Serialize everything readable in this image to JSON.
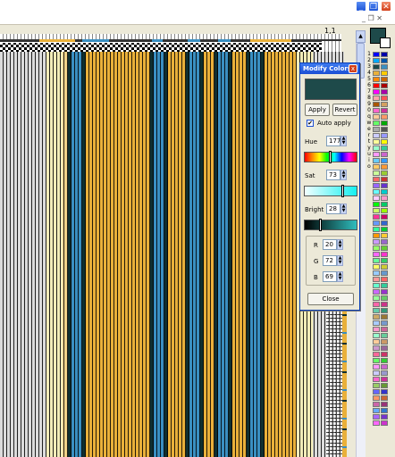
{
  "window": {
    "buttons": [
      "_",
      "❐",
      "✕"
    ],
    "secondary_buttons": [
      "_",
      "❐",
      "✕"
    ]
  },
  "status": {
    "coords": "1,1"
  },
  "dialog": {
    "title": "Modify Colors",
    "close_x": "x",
    "preview_color": "#1e4a4a",
    "apply_label": "Apply",
    "revert_label": "Revert",
    "auto_apply_label": "Auto apply",
    "auto_apply_checked": true,
    "hue_label": "Hue",
    "hue_value": "177",
    "sat_label": "Sat",
    "sat_value": "73",
    "bright_label": "Bright",
    "bright_value": "28",
    "r_label": "R",
    "r_value": "20",
    "g_label": "G",
    "g_value": "72",
    "b_label": "B",
    "b_value": "69",
    "close_label": "Close",
    "hue_fraction": 0.49,
    "sat_fraction": 0.73,
    "bright_fraction": 0.28
  },
  "palette": {
    "current_color": "#1e4a4a",
    "keys": [
      "1",
      "2",
      "3",
      "4",
      "5",
      "6",
      "7",
      "8",
      "9",
      "0",
      "q",
      "w",
      "e",
      "r",
      "t",
      "y",
      "u",
      "i",
      "o"
    ],
    "colors": [
      [
        "#0000ff",
        "#0000aa"
      ],
      [
        "#00aaff",
        "#0055aa"
      ],
      [
        "#1e4a4a",
        "#3a8fc1"
      ],
      [
        "#e9b03a",
        "#ffcc00"
      ],
      [
        "#ff8800",
        "#cc6600"
      ],
      [
        "#ff0000",
        "#aa0000"
      ],
      [
        "#ff00ff",
        "#aa00aa"
      ],
      [
        "#ffaaaa",
        "#ff5555"
      ],
      [
        "#aa5500",
        "#d4a060"
      ],
      [
        "#ff66cc",
        "#cc3399"
      ],
      [
        "#ffcc99",
        "#ff9966"
      ],
      [
        "#66ff66",
        "#00aa00"
      ],
      [
        "#aaaaaa",
        "#555555"
      ],
      [
        "#ccccff",
        "#9999ff"
      ],
      [
        "#ffff99",
        "#ffff00"
      ],
      [
        "#99ffcc",
        "#33cc99"
      ],
      [
        "#ff99ff",
        "#cc66cc"
      ],
      [
        "#66ccff",
        "#3399ff"
      ],
      [
        "#ffcc66",
        "#ff9933"
      ],
      [
        "#ccff99",
        "#99cc33"
      ],
      [
        "#ff6666",
        "#cc3333"
      ],
      [
        "#9966ff",
        "#6633cc"
      ],
      [
        "#66ffff",
        "#00cccc"
      ],
      [
        "#ffccff",
        "#ff99cc"
      ],
      [
        "#00ff00",
        "#00cc66"
      ],
      [
        "#ccff66",
        "#99ff00"
      ],
      [
        "#ff3399",
        "#cc0066"
      ],
      [
        "#6699ff",
        "#3366cc"
      ],
      [
        "#33ff99",
        "#00cc33"
      ],
      [
        "#ff9900",
        "#ffcc33"
      ],
      [
        "#cc99ff",
        "#9966cc"
      ],
      [
        "#99ff66",
        "#66cc33"
      ],
      [
        "#ff66ff",
        "#ff33cc"
      ],
      [
        "#66ff99",
        "#33cc66"
      ],
      [
        "#ffff66",
        "#cccc33"
      ],
      [
        "#99ccff",
        "#6699cc"
      ],
      [
        "#ff9999",
        "#ff6666"
      ],
      [
        "#66ffcc",
        "#33cc99"
      ],
      [
        "#cc66ff",
        "#9933cc"
      ],
      [
        "#99ff99",
        "#66cc66"
      ],
      [
        "#ff66aa",
        "#cc3388"
      ],
      [
        "#66ccaa",
        "#339977"
      ],
      [
        "#ccaa66",
        "#997733"
      ],
      [
        "#aaccff",
        "#7799cc"
      ],
      [
        "#ff99cc",
        "#cc6699"
      ],
      [
        "#99ffcc",
        "#66cc99"
      ],
      [
        "#ffcc99",
        "#cc9966"
      ],
      [
        "#cc99cc",
        "#996699"
      ],
      [
        "#ff6699",
        "#cc3366"
      ],
      [
        "#66ff66",
        "#33cc33"
      ],
      [
        "#ff99ff",
        "#cc66cc"
      ],
      [
        "#ccccff",
        "#9999cc"
      ],
      [
        "#ff66cc",
        "#cc3399"
      ],
      [
        "#99cc66",
        "#669933"
      ],
      [
        "#6666ff",
        "#3333cc"
      ],
      [
        "#ff9966",
        "#cc6633"
      ],
      [
        "#cc66aa",
        "#993377"
      ],
      [
        "#66aaff",
        "#3377cc"
      ],
      [
        "#aa66ff",
        "#7733cc"
      ],
      [
        "#ff66ff",
        "#cc33cc"
      ]
    ]
  }
}
